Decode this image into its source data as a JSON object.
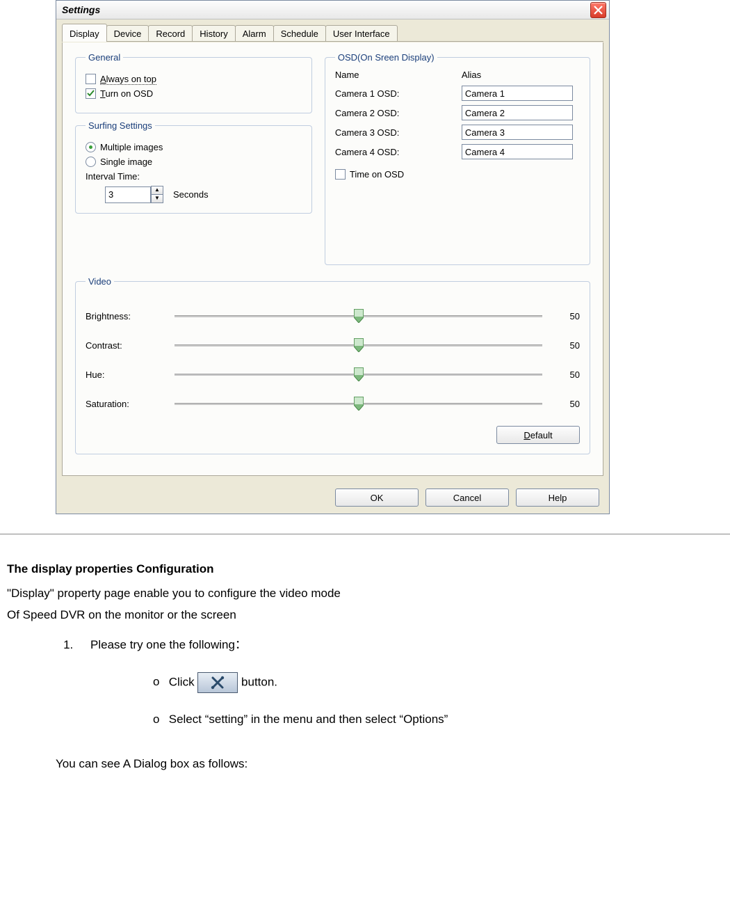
{
  "dialog": {
    "title": "Settings",
    "tabs": [
      "Display",
      "Device",
      "Record",
      "History",
      "Alarm",
      "Schedule",
      "User Interface"
    ],
    "active_tab": 0,
    "general": {
      "legend": "General",
      "always_on_top": {
        "label": "Always on top",
        "checked": false
      },
      "turn_on_osd": {
        "label": "Turn on OSD",
        "checked": true
      }
    },
    "surfing": {
      "legend": "Surfing Settings",
      "multiple": {
        "label": "Multiple images",
        "checked": true
      },
      "single": {
        "label": "Single image",
        "checked": false
      },
      "interval_label": "Interval Time:",
      "interval_value": "3",
      "interval_unit": "Seconds"
    },
    "osd": {
      "legend": "OSD(On Sreen Display)",
      "name_hdr": "Name",
      "alias_hdr": "Alias",
      "rows": [
        {
          "name": "Camera 1 OSD:",
          "alias": "Camera 1"
        },
        {
          "name": "Camera 2 OSD:",
          "alias": "Camera 2"
        },
        {
          "name": "Camera 3 OSD:",
          "alias": "Camera 3"
        },
        {
          "name": "Camera 4 OSD:",
          "alias": "Camera 4"
        }
      ],
      "time_on_osd": {
        "label": "Time on OSD",
        "checked": false
      }
    },
    "video": {
      "legend": "Video",
      "sliders": [
        {
          "label": "Brightness:",
          "value": 50
        },
        {
          "label": "Contrast:",
          "value": 50
        },
        {
          "label": "Hue:",
          "value": 50
        },
        {
          "label": "Saturation:",
          "value": 50
        }
      ],
      "default_btn_prefix": "D",
      "default_btn_rest": "efault"
    },
    "buttons": {
      "ok": "OK",
      "cancel": "Cancel",
      "help": "Help"
    }
  },
  "doc": {
    "heading": "The display properties Configuration",
    "p1": "\"Display\" property page enable you to configure the video mode",
    "p2": "Of Speed DVR on the monitor or the screen",
    "step1": "Please try one the following：",
    "sub1_a": "Click ",
    "sub1_b": "button.",
    "sub2": "Select “setting” in the menu and then select “Options”",
    "footer": "You can see A Dialog box as follows:"
  }
}
